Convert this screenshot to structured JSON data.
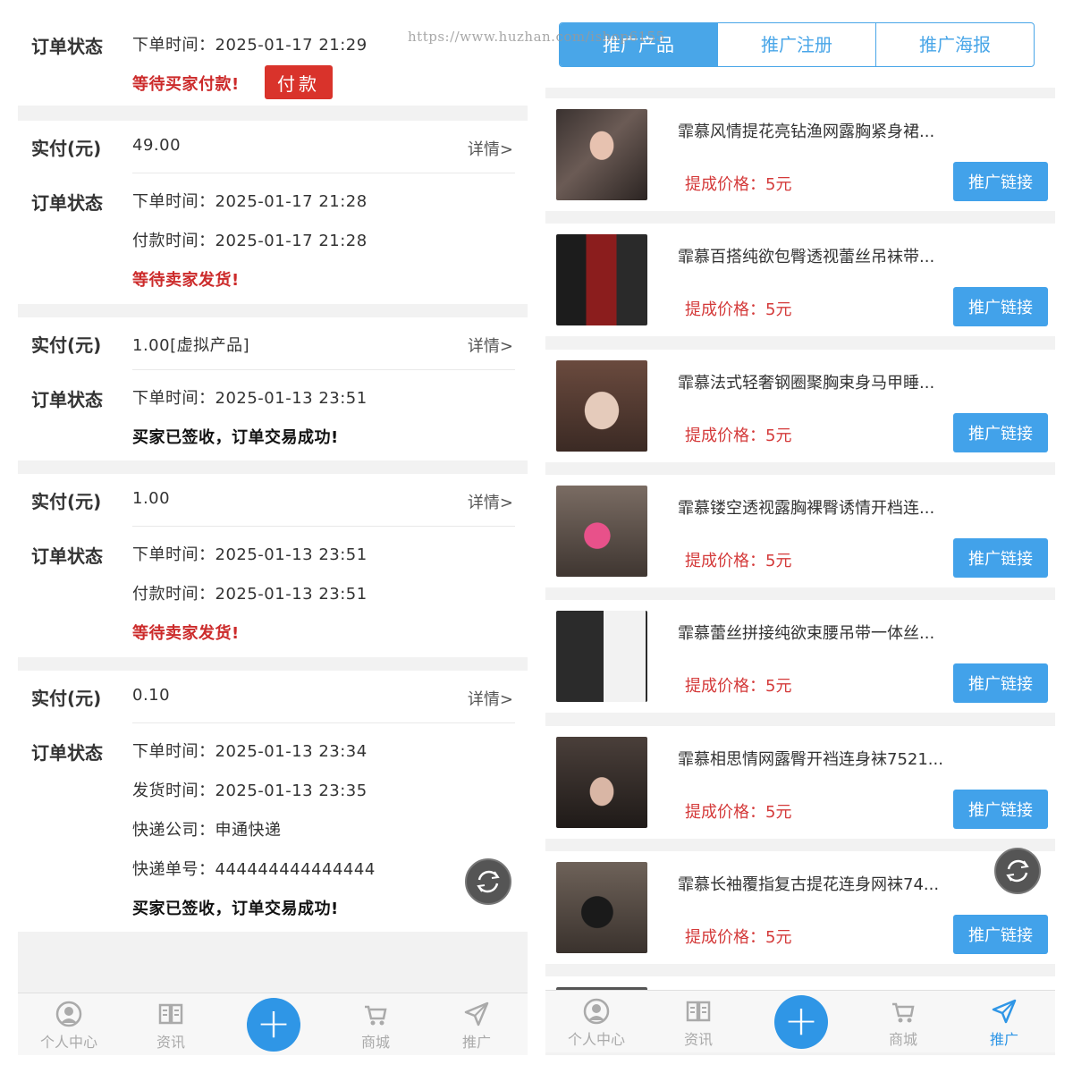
{
  "watermark": "https://www.huzhan.com/ishop6155",
  "orders": {
    "status_label": "订单状态",
    "paid_label": "实付(元)",
    "detail_label": "详情>",
    "first": {
      "line1": "下单时间：2025-01-17 21:29",
      "status": "等待买家付款!",
      "pay_button": "付款"
    },
    "items": [
      {
        "amount": "49.00",
        "lines": [
          "下单时间：2025-01-17 21:28",
          "付款时间：2025-01-17 21:28"
        ],
        "status": "等待卖家发货!"
      },
      {
        "amount": "1.00[虚拟产品]",
        "lines": [
          "下单时间：2025-01-13 23:51"
        ],
        "status": "买家已签收，订单交易成功!"
      },
      {
        "amount": "1.00",
        "lines": [
          "下单时间：2025-01-13 23:51",
          "付款时间：2025-01-13 23:51"
        ],
        "status": "等待卖家发货!"
      },
      {
        "amount": "0.10",
        "lines": [
          "下单时间：2025-01-13 23:34",
          "发货时间：2025-01-13 23:35",
          "快递公司：申通快递",
          "快递单号：444444444444444"
        ],
        "status": "买家已签收，订单交易成功!"
      }
    ]
  },
  "tabbar": {
    "left": [
      "个人中心",
      "资讯",
      "商城",
      "推广"
    ],
    "right": [
      "个人中心",
      "资讯",
      "商城",
      "推广"
    ],
    "active_right": "推广"
  },
  "promo_tabs": [
    "推广产品",
    "推广注册",
    "推广海报"
  ],
  "products": {
    "price_label": "提成价格：5元",
    "button_label": "推广链接",
    "items": [
      "霏慕风情提花亮钻渔网露胸紧身裙...",
      "霏慕百搭纯欲包臀透视蕾丝吊袜带...",
      "霏慕法式轻奢钢圈聚胸束身马甲睡...",
      "霏慕镂空透视露胸裸臀诱情开档连...",
      "霏慕蕾丝拼接纯欲束腰吊带一体丝...",
      "霏慕相思情网露臀开裆连身袜7521...",
      "霏慕长袖覆指复古提花连身网袜74..."
    ]
  },
  "colors": {
    "accent_blue": "#49a6e8",
    "pay_red": "#d9332b",
    "status_red": "#cc2b2b",
    "plus_blue": "#2f96e6"
  },
  "icons": [
    "person-icon",
    "book-icon",
    "plus-icon",
    "cart-icon",
    "send-icon",
    "refresh-icon"
  ]
}
